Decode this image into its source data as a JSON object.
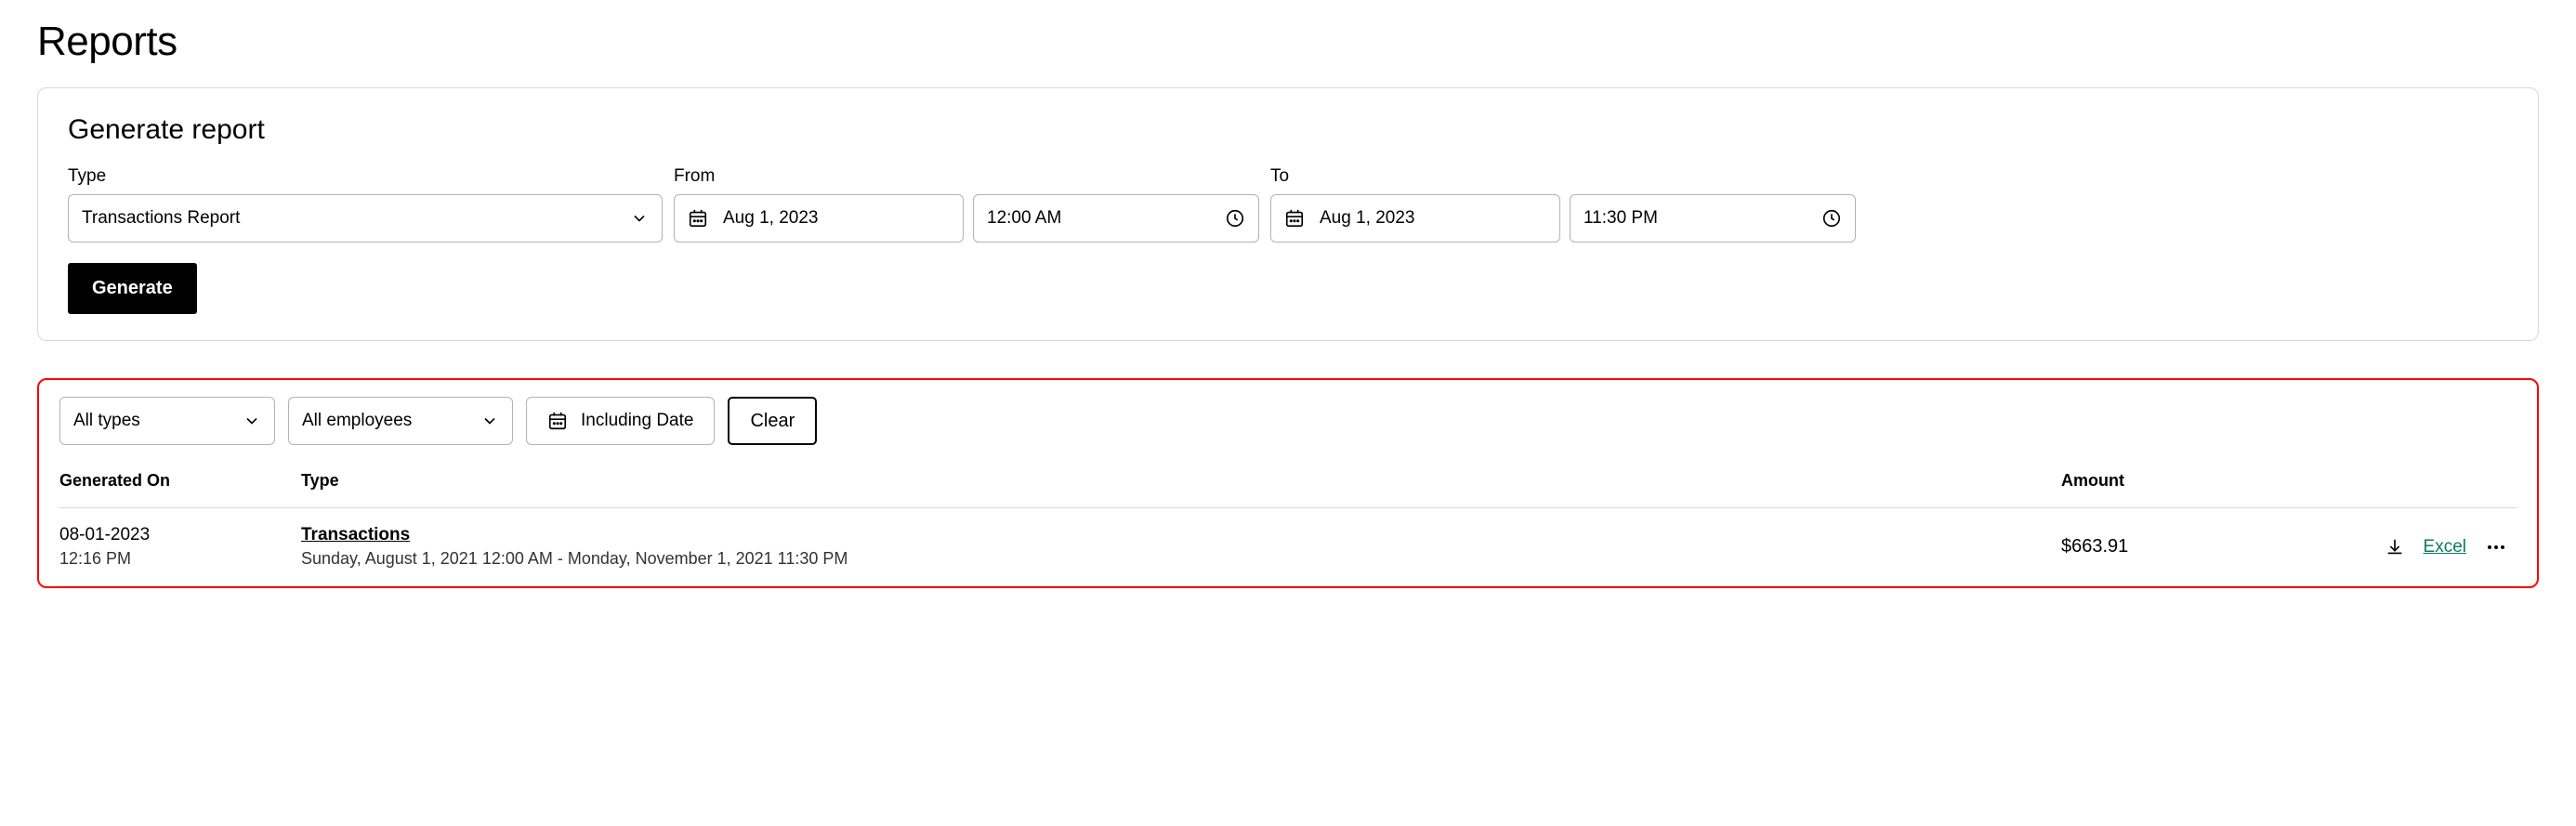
{
  "page": {
    "title": "Reports"
  },
  "generate": {
    "card_title": "Generate report",
    "type_label": "Type",
    "type_value": "Transactions Report",
    "from_label": "From",
    "from_date": "Aug 1, 2023",
    "from_time": "12:00 AM",
    "to_label": "To",
    "to_date": "Aug 1, 2023",
    "to_time": "11:30 PM",
    "button_label": "Generate"
  },
  "filters": {
    "type_value": "All types",
    "employee_value": "All employees",
    "including_date_label": "Including Date",
    "clear_label": "Clear"
  },
  "table": {
    "headers": {
      "generated_on": "Generated On",
      "type": "Type",
      "amount": "Amount"
    },
    "rows": [
      {
        "date": "08-01-2023",
        "time": "12:16 PM",
        "type_name": "Transactions",
        "range": "Sunday, August 1, 2021 12:00 AM - Monday, November 1, 2021 11:30 PM",
        "amount": "$663.91",
        "download_label": "Excel"
      }
    ]
  }
}
